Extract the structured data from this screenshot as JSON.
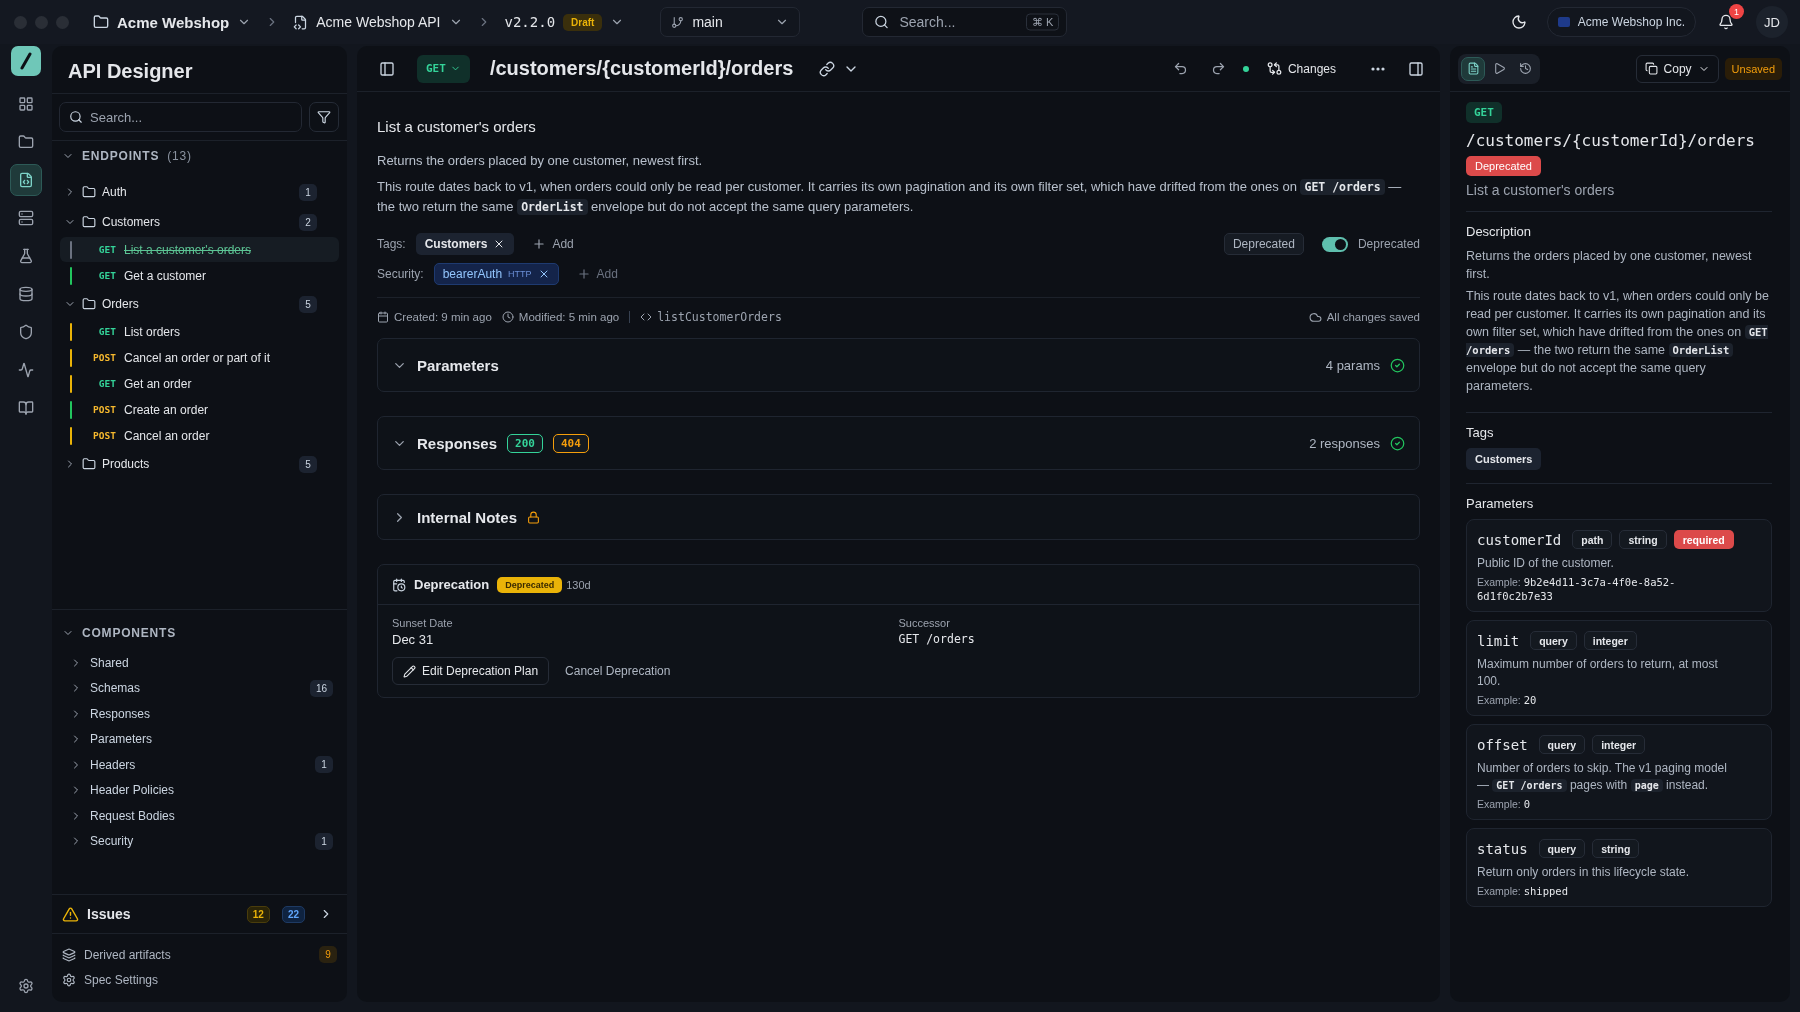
{
  "topbar": {
    "workspace": "Acme Webshop",
    "project": "Acme Webshop API",
    "version": "v2.2.0",
    "version_badge": "Draft",
    "branch": "main",
    "search": {
      "placeholder": "Search...",
      "shortcut": "⌘ K"
    },
    "org": "Acme Webshop Inc.",
    "notifications": "1",
    "avatar": "JD"
  },
  "rail": [
    {
      "kind": "grid",
      "selected": false
    },
    {
      "kind": "folder",
      "selected": false
    },
    {
      "kind": "code",
      "selected": true
    },
    {
      "kind": "server",
      "selected": false
    },
    {
      "kind": "flask",
      "selected": false
    },
    {
      "kind": "database",
      "selected": false
    },
    {
      "kind": "shield",
      "selected": false
    },
    {
      "kind": "activity",
      "selected": false
    },
    {
      "kind": "book",
      "selected": false
    }
  ],
  "sidebar": {
    "title": "API Designer",
    "search": {
      "placeholder": "Search..."
    },
    "endpoints": {
      "label": "ENDPOINTS",
      "count": "(13)",
      "expanded": true,
      "groups": [
        {
          "name": "Auth",
          "count": "1",
          "expanded": false
        },
        {
          "name": "Customers",
          "count": "2",
          "expanded": true,
          "items": [
            {
              "method": "GET",
              "name": "List a customer's orders",
              "color": "#6b7280",
              "selected": true,
              "deprecated": true
            },
            {
              "method": "GET",
              "name": "Get a customer",
              "color": "#22c55e",
              "selected": false,
              "deprecated": false
            }
          ]
        },
        {
          "name": "Orders",
          "count": "5",
          "expanded": true,
          "items": [
            {
              "method": "GET",
              "name": "List orders",
              "color": "#eab308",
              "selected": false,
              "deprecated": false
            },
            {
              "method": "POST",
              "name": "Cancel an order or part of it",
              "color": "#eab308",
              "selected": false,
              "deprecated": false
            },
            {
              "method": "GET",
              "name": "Get an order",
              "color": "#eab308",
              "selected": false,
              "deprecated": false
            },
            {
              "method": "POST",
              "name": "Create an order",
              "color": "#22c55e",
              "selected": false,
              "deprecated": false
            },
            {
              "method": "POST",
              "name": "Cancel an order",
              "color": "#eab308",
              "selected": false,
              "deprecated": false
            }
          ]
        },
        {
          "name": "Products",
          "count": "5",
          "expanded": false
        }
      ]
    },
    "components": {
      "label": "COMPONENTS",
      "expanded": true,
      "items": [
        {
          "name": "Shared"
        },
        {
          "name": "Schemas",
          "count": "16"
        },
        {
          "name": "Responses"
        },
        {
          "name": "Parameters"
        },
        {
          "name": "Headers",
          "count": "1"
        },
        {
          "name": "Header Policies"
        },
        {
          "name": "Request Bodies"
        },
        {
          "name": "Security",
          "count": "1"
        }
      ]
    },
    "issues": {
      "label": "Issues",
      "warnings": "12",
      "infos": "22"
    },
    "footer": [
      {
        "kind": "layers",
        "label": "Derived artifacts",
        "count": "9"
      },
      {
        "kind": "gear",
        "label": "Spec Settings"
      }
    ]
  },
  "main": {
    "method": "GET",
    "path": "/customers/{customerId}/orders",
    "changes": "Changes",
    "title": "List a customer's orders",
    "description": [
      [
        {
          "text": "Returns the orders placed by one customer, newest first.",
          "code": false
        }
      ],
      [
        {
          "text": "This route dates back to v1, when orders could only be read per customer. It carries its own pagination and its own filter set, which have drifted from the ones on ",
          "code": false
        },
        {
          "text": "GET /orders",
          "code": true
        },
        {
          "text": " — the two return the same ",
          "code": false
        },
        {
          "text": "OrderList",
          "code": true
        },
        {
          "text": " envelope but do not accept the same query parameters.",
          "code": false
        }
      ]
    ],
    "tags": {
      "label": "Tags:",
      "items": [
        "Customers"
      ],
      "add": "Add"
    },
    "status_badge": "Deprecated",
    "deprecated_toggle": {
      "on": true,
      "label": "Deprecated"
    },
    "security": {
      "label": "Security:",
      "items": [
        {
          "name": "bearerAuth",
          "type": "HTTP"
        }
      ],
      "add": "Add"
    },
    "meta": {
      "created": "Created: 9 min ago",
      "modified": "Modified: 5 min ago",
      "operation_id": "listCustomerOrders",
      "saved": "All changes saved"
    },
    "sections": [
      {
        "title": "Parameters",
        "expanded": true,
        "summary": "4 params",
        "valid": true
      },
      {
        "title": "Responses",
        "expanded": true,
        "codes": [
          {
            "label": "200",
            "color": "#34d399"
          },
          {
            "label": "404",
            "color": "#f59e0b"
          }
        ],
        "summary": "2 responses",
        "valid": true
      },
      {
        "title": "Internal Notes",
        "expanded": false,
        "locked": true
      }
    ],
    "deprecation": {
      "title": "Deprecation",
      "badge": "Deprecated",
      "age": "130d",
      "fields": [
        {
          "label": "Sunset Date",
          "value": "Dec 31",
          "code": false
        },
        {
          "label": "Successor",
          "value": "GET /orders",
          "code": true
        }
      ],
      "edit": "Edit Deprecation Plan",
      "cancel": "Cancel Deprecation"
    }
  },
  "preview": {
    "tabs": [
      {
        "kind": "doc",
        "selected": true
      },
      {
        "kind": "play",
        "selected": false
      },
      {
        "kind": "history",
        "selected": false
      }
    ],
    "copy": "Copy",
    "unsaved": "Unsaved",
    "method": "GET",
    "path": "/customers/{customerId}/orders",
    "status": "Deprecated",
    "summary": "List a customer's orders",
    "description_heading": "Description",
    "description": [
      [
        {
          "text": "Returns the orders placed by one customer, newest first.",
          "code": false
        }
      ],
      [
        {
          "text": "This route dates back to v1, when orders could only be read per customer. It carries its own pagination and its own filter set, which have drifted from the ones on ",
          "code": false
        },
        {
          "text": "GET /orders",
          "code": true
        },
        {
          "text": " — the two return the same ",
          "code": false
        },
        {
          "text": "OrderList",
          "code": true
        },
        {
          "text": " envelope but do not accept the same query parameters.",
          "code": false
        }
      ]
    ],
    "tags_heading": "Tags",
    "tags": [
      "Customers"
    ],
    "params_heading": "Parameters",
    "params": [
      {
        "name": "customerId",
        "in": "path",
        "type": "string",
        "required": true,
        "required_label": "required",
        "description": [
          {
            "text": "Public ID of the customer.",
            "code": false
          }
        ],
        "example_label": "Example:",
        "example": "9b2e4d11-3c7a-4f0e-8a52-6d1f0c2b7e33"
      },
      {
        "name": "limit",
        "in": "query",
        "type": "integer",
        "required": false,
        "description": [
          {
            "text": "Maximum number of orders to return, at most 100.",
            "code": false
          }
        ],
        "example_label": "Example:",
        "example": "20"
      },
      {
        "name": "offset",
        "in": "query",
        "type": "integer",
        "required": false,
        "description": [
          {
            "text": "Number of orders to skip. The v1 paging model — ",
            "code": false
          },
          {
            "text": "GET /orders",
            "code": true
          },
          {
            "text": " pages with ",
            "code": false
          },
          {
            "text": "page",
            "code": true
          },
          {
            "text": " instead.",
            "code": false
          }
        ],
        "example_label": "Example:",
        "example": "0"
      },
      {
        "name": "status",
        "in": "query",
        "type": "string",
        "required": false,
        "description": [
          {
            "text": "Return only orders in this lifecycle state.",
            "code": false
          }
        ],
        "example_label": "Example:",
        "example": "shipped"
      }
    ]
  }
}
